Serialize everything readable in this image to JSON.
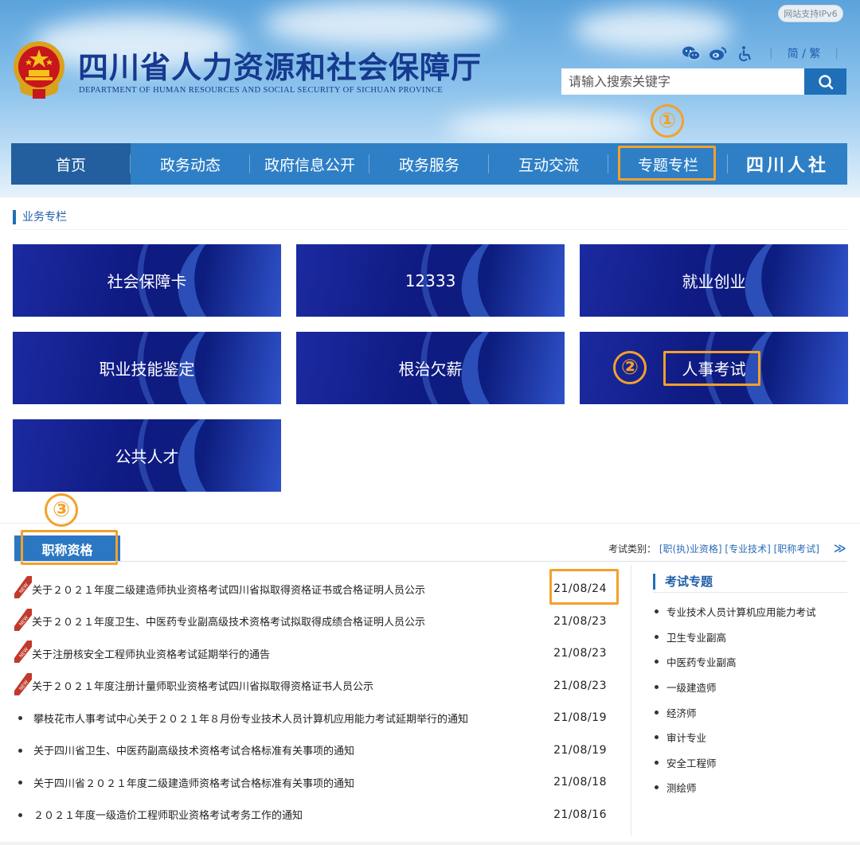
{
  "header": {
    "ipv6_badge": "网站支持IPv6",
    "site_title": "四川省人力资源和社会保障厅",
    "site_subtitle": "DEPARTMENT OF HUMAN RESOURCES AND SOCIAL SECURITY OF SICHUAN PROVINCE",
    "lang_toggle": "简 / 繁",
    "search_placeholder": "请输入搜索关键字",
    "icons": [
      "wechat-icon",
      "weibo-icon",
      "accessibility-icon",
      "search-icon"
    ]
  },
  "nav": {
    "items": [
      "首页",
      "政务动态",
      "政府信息公开",
      "政务服务",
      "互动交流",
      "专题专栏"
    ],
    "logo_text": "四川人社",
    "active_index": 0
  },
  "section": {
    "title": "业务专栏",
    "tiles": [
      "社会保障卡",
      "12333",
      "就业创业",
      "职业技能鉴定",
      "根治欠薪",
      "人事考试",
      "公共人才"
    ]
  },
  "callouts": [
    "①",
    "②",
    "③"
  ],
  "exam": {
    "active_tab": "职称资格",
    "types_label": "考试类别：",
    "types": [
      "[职(执)业资格]",
      "[专业技术]",
      "[职称考试]"
    ],
    "more": "≫",
    "news": [
      {
        "title": "关于２０２１年度二级建造师执业资格考试四川省拟取得资格证书或合格证明人员公示",
        "date": "21/08/24",
        "is_new": true
      },
      {
        "title": "关于２０２１年度卫生、中医药专业副高级技术资格考试拟取得成绩合格证明人员公示",
        "date": "21/08/23",
        "is_new": true
      },
      {
        "title": "关于注册核安全工程师执业资格考试延期举行的通告",
        "date": "21/08/23",
        "is_new": true
      },
      {
        "title": "关于２０２１年度注册计量师职业资格考试四川省拟取得资格证书人员公示",
        "date": "21/08/23",
        "is_new": true
      },
      {
        "title": "攀枝花市人事考试中心关于２０２１年８月份专业技术人员计算机应用能力考试延期举行的通知",
        "date": "21/08/19",
        "is_new": false
      },
      {
        "title": "关于四川省卫生、中医药副高级技术资格考试合格标准有关事项的通知",
        "date": "21/08/19",
        "is_new": false
      },
      {
        "title": "关于四川省２０２１年度二级建造师资格考试合格标准有关事项的通知",
        "date": "21/08/18",
        "is_new": false
      },
      {
        "title": "２０２１年度一级造价工程师职业资格考试考务工作的通知",
        "date": "21/08/16",
        "is_new": false
      }
    ],
    "side_title": "考试专题",
    "side_items": [
      "专业技术人员计算机应用能力考试",
      "卫生专业副高",
      "中医药专业副高",
      "一级建造师",
      "经济师",
      "审计专业",
      "安全工程师",
      "测绘师"
    ]
  },
  "colors": {
    "brand_blue": "#2e7fc6",
    "title_blue": "#163a8f",
    "callout_orange": "#f3a12a",
    "tile_navy": "#0f1a82",
    "new_badge_red": "#c0392b"
  }
}
